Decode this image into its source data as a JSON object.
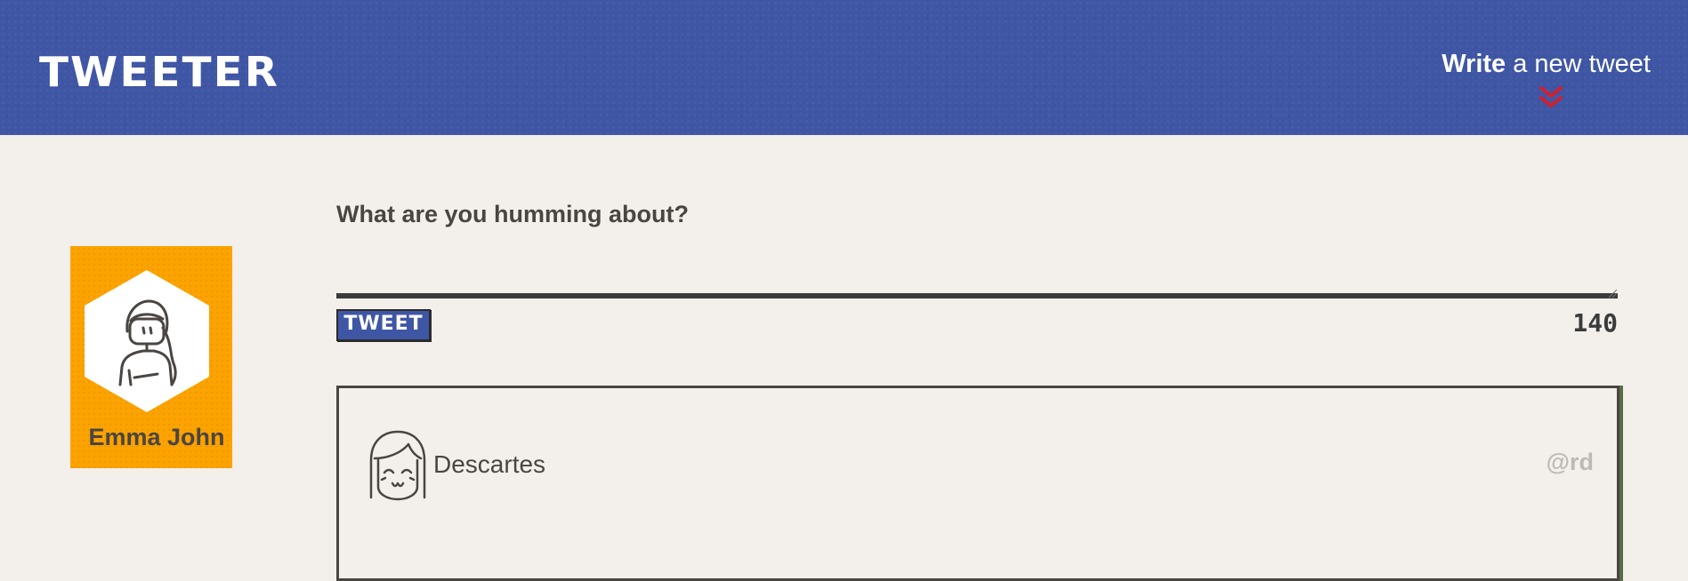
{
  "nav": {
    "brand": "TWEETER",
    "compose_bold": "Write",
    "compose_rest": " a new tweet",
    "chevron_icon": "double-chevron-down-icon",
    "background_color": "#3f56a5",
    "chevron_color": "#d0202e"
  },
  "profile": {
    "name": "Emma John",
    "avatar_icon": "woman-avatar-icon",
    "background_color": "#fda300"
  },
  "composer": {
    "label": "What are you humming about?",
    "textarea_value": "",
    "submit_label": "TWEET",
    "char_counter": "140"
  },
  "tweets": [
    {
      "avatar_icon": "girl-face-avatar-icon",
      "name": "Descartes",
      "handle": "@rd"
    }
  ]
}
